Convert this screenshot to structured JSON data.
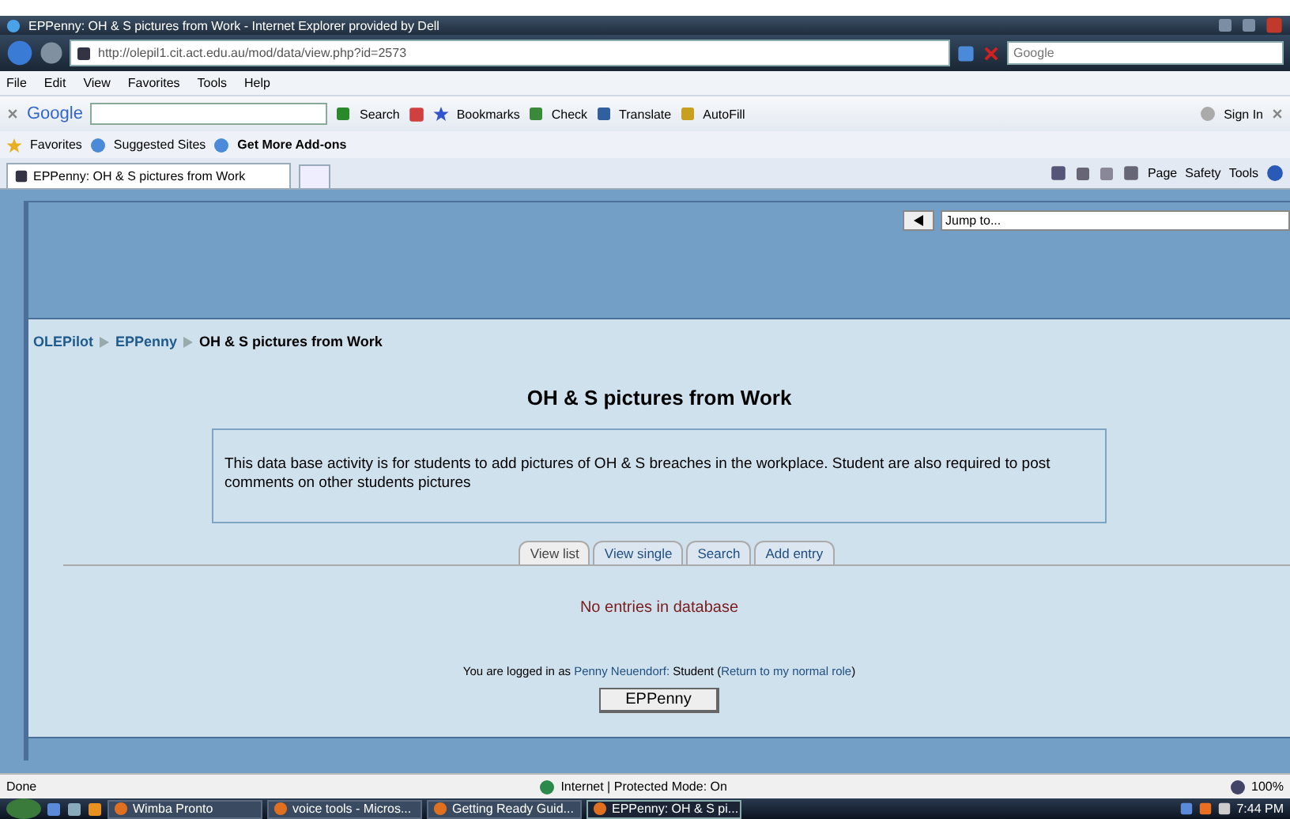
{
  "window": {
    "title": "EPPenny: OH & S pictures from Work - Internet Explorer provided by Dell"
  },
  "address_bar": {
    "url": "http://olepil1.cit.act.edu.au/mod/data/view.php?id=2573"
  },
  "search_box": {
    "placeholder": "Google"
  },
  "menu": [
    "File",
    "Edit",
    "View",
    "Favorites",
    "Tools",
    "Help"
  ],
  "google_toolbar": {
    "logo": "Google",
    "items": [
      "Search",
      "Bookmarks",
      "Check",
      "Translate",
      "AutoFill",
      "Sign In"
    ]
  },
  "favorites_bar": [
    "Favorites",
    "Suggested Sites",
    "Get More Add-ons"
  ],
  "browser_tab": {
    "title": "EPPenny: OH & S pictures from Work"
  },
  "command_bar": [
    "Page",
    "Safety",
    "Tools"
  ],
  "page": {
    "jump_to": "Jump to...",
    "breadcrumb": [
      {
        "label": "OLEPilot",
        "link": true
      },
      {
        "label": "EPPenny",
        "link": true
      },
      {
        "label": "OH & S pictures from Work",
        "link": false
      }
    ],
    "heading": "OH & S pictures from Work",
    "intro": "This data base activity is for students to add pictures of OH & S breaches in the workplace. Student are also required to post comments on other students pictures",
    "tabs": [
      {
        "label": "View list",
        "selected": true
      },
      {
        "label": "View single",
        "selected": false
      },
      {
        "label": "Search",
        "selected": false
      },
      {
        "label": "Add entry",
        "selected": false
      }
    ],
    "message": "No entries in database",
    "login": {
      "prefix": "You are logged in as",
      "user": "Penny Neuendorf:",
      "middle": "Student (",
      "role_link": "Return to my normal role",
      "suffix": ")"
    },
    "course_button": "EPPenny"
  },
  "status_bar": {
    "status": "Done",
    "zone": "Internet | Protected Mode: On",
    "zoom": "100%"
  },
  "taskbar": {
    "items": [
      {
        "label": "Wimba Pronto",
        "selected": false
      },
      {
        "label": "voice tools - Micros...",
        "selected": false
      },
      {
        "label": "Getting Ready Guid...",
        "selected": false
      },
      {
        "label": "EPPenny: OH & S pi...",
        "selected": true
      }
    ],
    "clock": "7:44 PM"
  }
}
